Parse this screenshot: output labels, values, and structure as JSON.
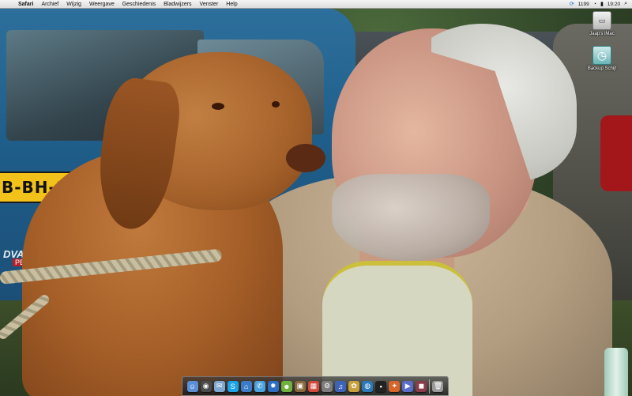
{
  "menubar": {
    "apple_glyph": "",
    "app_name": "Safari",
    "items": [
      "Archief",
      "Wijzig",
      "Weergave",
      "Geschiedenis",
      "Bladwijzers",
      "Venster",
      "Help"
    ],
    "status": {
      "sync_glyph": "⟳",
      "number_readout": "1199",
      "wifi_glyph": "◔",
      "battery_glyph": "▮",
      "clock": "19:20",
      "search_glyph": "⌕"
    }
  },
  "desktop": {
    "icons": [
      {
        "label": "Jaap's iMac",
        "icon": "hard-drive-icon"
      },
      {
        "label": "Backup Schijf",
        "icon": "time-machine-icon"
      }
    ]
  },
  "wallpaper": {
    "license_plate": "B-BH-14",
    "bumper_text": "DVA OBU",
    "bumper_logo": "PEBINA"
  },
  "dock": {
    "apps": [
      {
        "name": "finder",
        "glyph": "☺",
        "color": "#5a8fd6"
      },
      {
        "name": "dashboard",
        "glyph": "◉",
        "color": "#4b4b4b"
      },
      {
        "name": "mail",
        "glyph": "✉",
        "color": "#7fa7d0"
      },
      {
        "name": "skype",
        "glyph": "S",
        "color": "#1aa3e8"
      },
      {
        "name": "network",
        "glyph": "⌂",
        "color": "#3b7cc9"
      },
      {
        "name": "messages",
        "glyph": "✆",
        "color": "#4aa3df"
      },
      {
        "name": "safari",
        "glyph": "✹",
        "color": "#2c6fc2"
      },
      {
        "name": "ichat",
        "glyph": "☻",
        "color": "#6fb13c"
      },
      {
        "name": "photos",
        "glyph": "▣",
        "color": "#8a6a3c"
      },
      {
        "name": "calendar",
        "glyph": "▦",
        "color": "#d14a3c"
      },
      {
        "name": "preferences",
        "glyph": "⚙",
        "color": "#7d7d7d"
      },
      {
        "name": "itunes",
        "glyph": "♫",
        "color": "#3d63b9"
      },
      {
        "name": "iphoto",
        "glyph": "✿",
        "color": "#c9a13c"
      },
      {
        "name": "world",
        "glyph": "◍",
        "color": "#2a7ab9"
      },
      {
        "name": "terminal",
        "glyph": "▪",
        "color": "#222222"
      },
      {
        "name": "firefox",
        "glyph": "✦",
        "color": "#d8652a"
      },
      {
        "name": "quicktime",
        "glyph": "▶",
        "color": "#5a6ec9"
      },
      {
        "name": "photo-booth",
        "glyph": "◼",
        "color": "#8b3c4a"
      },
      {
        "name": "trash",
        "glyph": "🗑",
        "color": "#9a9a9a"
      }
    ]
  }
}
